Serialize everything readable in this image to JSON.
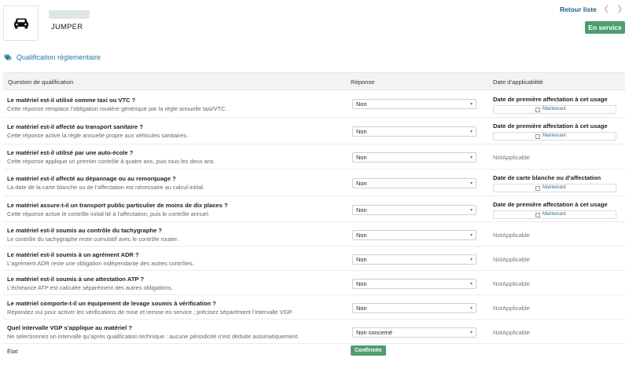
{
  "header": {
    "vehicle_name": "JUMPER",
    "back_link": "Retour liste",
    "status_button": "En service",
    "vehicle_icon": "car-icon",
    "prev_icon": "chevron-left-icon",
    "next_icon": "chevron-right-icon"
  },
  "section": {
    "icon": "tags-icon",
    "title": "Qualification réglementaire"
  },
  "table": {
    "headers": {
      "question": "Question de qualification",
      "response": "Réponse",
      "date": "Date d’applicabilité"
    },
    "rows": [
      {
        "title": "Le matériel est-il utilisé comme taxi ou VTC ?",
        "desc": "Cette réponse remplace l’obligation routière générique par la règle annuelle taxi/VTC.",
        "response": "Non",
        "date_label": "Date de première affectation à cet usage",
        "maintenant": "Maintenant",
        "not_applicable": ""
      },
      {
        "title": "Le matériel est-il affecté au transport sanitaire ?",
        "desc": "Cette réponse active la règle annuelle propre aux véhicules sanitaires.",
        "response": "Non",
        "date_label": "Date de première affectation à cet usage",
        "maintenant": "Maintenant",
        "not_applicable": ""
      },
      {
        "title": "Le matériel est-il utilisé par une auto-école ?",
        "desc": "Cette réponse applique un premier contrôle à quatre ans, puis tous les deux ans.",
        "response": "Non",
        "date_label": "",
        "maintenant": "",
        "not_applicable": "NotApplicable"
      },
      {
        "title": "Le matériel est-il affecté au dépannage ou au remorquage ?",
        "desc": "La date de la carte blanche ou de l’affectation est nécessaire au calcul initial.",
        "response": "Non",
        "date_label": "Date de carte blanche ou d’affectation",
        "maintenant": "Maintenant",
        "not_applicable": ""
      },
      {
        "title": "Le matériel assure-t-il un transport public particulier de moins de dix places ?",
        "desc": "Cette réponse active le contrôle initial lié à l’affectation, puis le contrôle annuel.",
        "response": "Non",
        "date_label": "Date de première affectation à cet usage",
        "maintenant": "Maintenant",
        "not_applicable": ""
      },
      {
        "title": "Le matériel est-il soumis au contrôle du tachygraphe ?",
        "desc": "Le contrôle du tachygraphe reste cumulatif avec le contrôle routier.",
        "response": "Non",
        "date_label": "",
        "maintenant": "",
        "not_applicable": "NotApplicable"
      },
      {
        "title": "Le matériel est-il soumis à un agrément ADR ?",
        "desc": "L’agrément ADR reste une obligation indépendante des autres contrôles.",
        "response": "Non",
        "date_label": "",
        "maintenant": "",
        "not_applicable": "NotApplicable"
      },
      {
        "title": "Le matériel est-il soumis à une attestation ATP ?",
        "desc": "L’échéance ATP est calculée séparément des autres obligations.",
        "response": "Non",
        "date_label": "",
        "maintenant": "",
        "not_applicable": "NotApplicable"
      },
      {
        "title": "Le matériel comporte-t-il un équipement de levage soumis à vérification ?",
        "desc": "Répondez oui pour activer les vérifications de mise et remise en service ; précisez séparément l’intervalle VGP.",
        "response": "Non",
        "date_label": "",
        "maintenant": "",
        "not_applicable": "NotApplicable"
      },
      {
        "title": "Quel intervalle VGP s’applique au matériel ?",
        "desc": "Ne sélectionnez un intervalle qu’après qualification technique : aucune périodicité n’est déduite automatiquement.",
        "response": "Non concerné",
        "date_label": "",
        "maintenant": "",
        "not_applicable": "NotApplicable"
      }
    ]
  },
  "state": {
    "label": "État",
    "badge": "Confirmée"
  }
}
